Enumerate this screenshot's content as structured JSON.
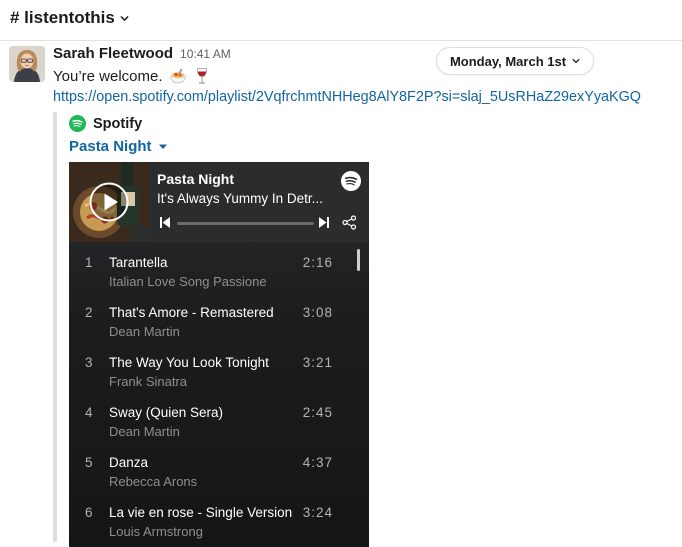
{
  "channel": {
    "name": "# listentothis"
  },
  "message": {
    "author": "Sarah Fleetwood",
    "time": "10:41 AM",
    "text": "You’re welcome.",
    "emojis": [
      "spaghetti-emoji",
      "wine-glass-emoji"
    ],
    "link": "https://open.spotify.com/playlist/2VqfrchmtNHHeg8AlY8F2P?si=slaj_5UsRHaZ29exYyaKGQ"
  },
  "date_pill": {
    "label": "Monday, March 1st"
  },
  "attachment": {
    "provider": "Spotify",
    "title": "Pasta Night",
    "embed": {
      "title": "Pasta Night",
      "subtitle": "It's Always Yummy In Detr...",
      "progress": 0,
      "tracks": [
        {
          "num": "1",
          "name": "Tarantella",
          "artist": "Italian Love Song Passione",
          "duration": "2:16"
        },
        {
          "num": "2",
          "name": "That's Amore - Remastered",
          "artist": "Dean Martin",
          "duration": "3:08"
        },
        {
          "num": "3",
          "name": "The Way You Look Tonight",
          "artist": "Frank Sinatra",
          "duration": "3:21"
        },
        {
          "num": "4",
          "name": "Sway (Quien Sera)",
          "artist": "Dean Martin",
          "duration": "2:45"
        },
        {
          "num": "5",
          "name": "Danza",
          "artist": "Rebecca Arons",
          "duration": "4:37"
        },
        {
          "num": "6",
          "name": "La vie en rose - Single Version",
          "artist": "Louis Armstrong",
          "duration": "3:24"
        }
      ]
    }
  },
  "colors": {
    "link": "#1264a3",
    "spotify_green": "#1db954",
    "embed_bg": "#1c1d1f"
  },
  "icons": [
    "chevron-down-icon",
    "spotify-icon",
    "play-icon",
    "previous-icon",
    "next-icon",
    "share-icon",
    "caret-down-icon"
  ]
}
